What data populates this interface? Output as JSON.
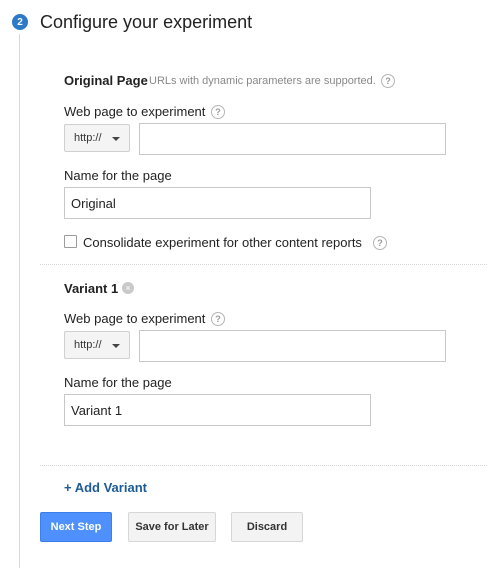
{
  "step": {
    "number": "2",
    "title": "Configure your experiment"
  },
  "original": {
    "title": "Original Page",
    "note": "URLs with dynamic parameters are supported.",
    "url_label": "Web page to experiment",
    "protocol": "http://",
    "url_value": "",
    "name_label": "Name for the page",
    "name_value": "Original",
    "consolidate_label": "Consolidate experiment for other content reports",
    "consolidate_checked": false
  },
  "variant1": {
    "title": "Variant 1",
    "url_label": "Web page to experiment",
    "protocol": "http://",
    "url_value": "",
    "name_label": "Name for the page",
    "name_value": "Variant 1"
  },
  "add_variant": "+ Add Variant",
  "buttons": {
    "next": "Next Step",
    "save": "Save for Later",
    "discard": "Discard"
  },
  "icons": {
    "help": "?",
    "remove": "×"
  },
  "colors": {
    "accent": "#2d7ac9",
    "primary_button": "#4d90fe",
    "link": "#1e5a96"
  }
}
